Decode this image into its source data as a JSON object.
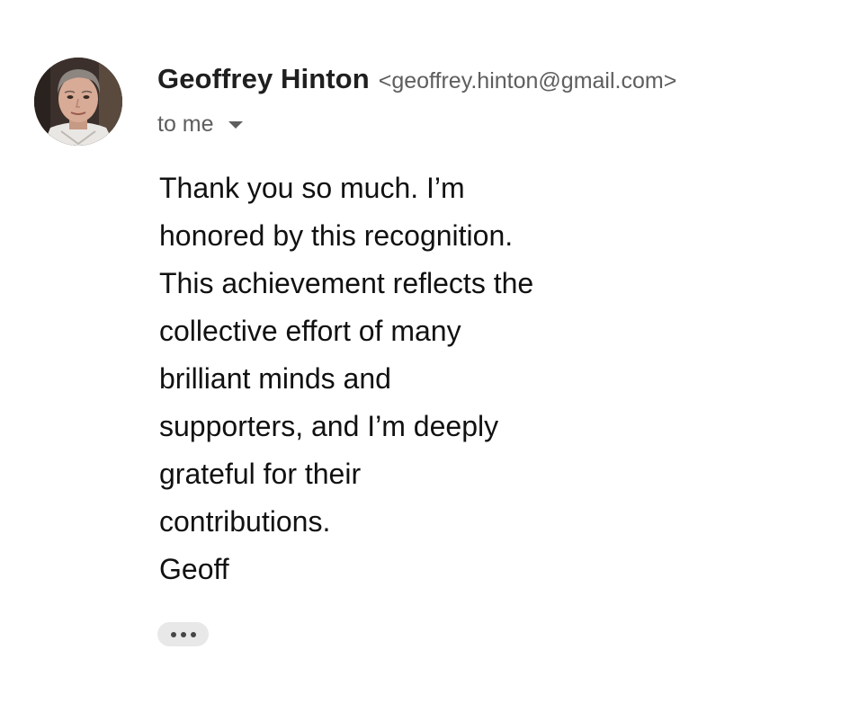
{
  "email": {
    "sender": {
      "name": "Geoffrey Hinton",
      "email": "<geoffrey.hinton@gmail.com>",
      "avatar_icon": "profile-photo"
    },
    "recipient_label": "to me",
    "recipient_toggle_icon": "caret-down-icon",
    "body_lines": [
      "Thank you so much. I’m",
      "honored by this recognition.",
      "This achievement reflects the",
      "collective effort of many",
      "brilliant minds and",
      "supporters, and I’m deeply",
      "grateful for their",
      "contributions.",
      "Geoff"
    ],
    "trimmed_content_icon": "more-horiz-icon"
  },
  "colors": {
    "text_primary": "#1f1f1f",
    "text_secondary": "#5e5e5e",
    "chip_background": "#e8e8e8"
  }
}
